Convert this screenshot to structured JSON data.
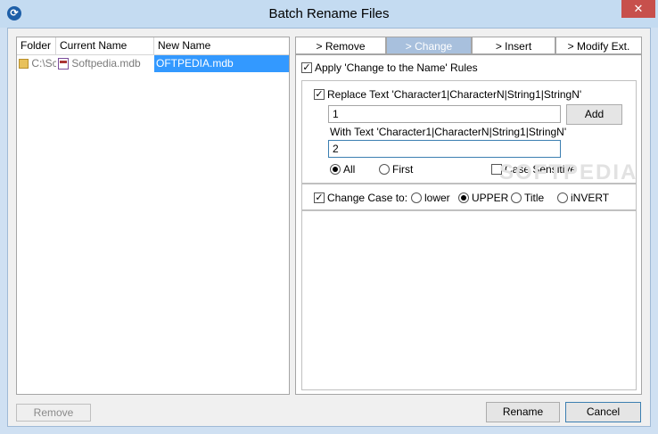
{
  "window": {
    "title": "Batch Rename Files",
    "close_glyph": "✕",
    "app_icon_glyph": "⟳"
  },
  "file_list": {
    "columns": [
      "Folder",
      "Current Name",
      "New Name"
    ],
    "rows": [
      {
        "folder": "C:\\Sc",
        "current_name": "Softpedia.mdb",
        "new_name": "OFTPEDIA.mdb"
      }
    ]
  },
  "tabs": [
    "> Remove",
    "> Change",
    "> Insert",
    "> Modify Ext."
  ],
  "change_panel": {
    "apply_label": "Apply 'Change to the Name' Rules",
    "replace_label": "Replace Text  'Character1|CharacterN|String1|StringN'",
    "replace_value": "1",
    "add_button": "Add",
    "with_label": "With Text  'Character1|CharacterN|String1|StringN'",
    "with_value": "2",
    "all_label": "All",
    "first_label": "First",
    "case_sensitive_label": "Case Sensitive",
    "change_case_label": "Change Case to:",
    "lower_label": "lower",
    "upper_label": "UPPER",
    "title_label": "Title",
    "invert_label": "iNVERT"
  },
  "footer": {
    "remove_button": "Remove",
    "rename_button": "Rename",
    "cancel_button": "Cancel"
  },
  "watermark": "SOFTPEDIA"
}
